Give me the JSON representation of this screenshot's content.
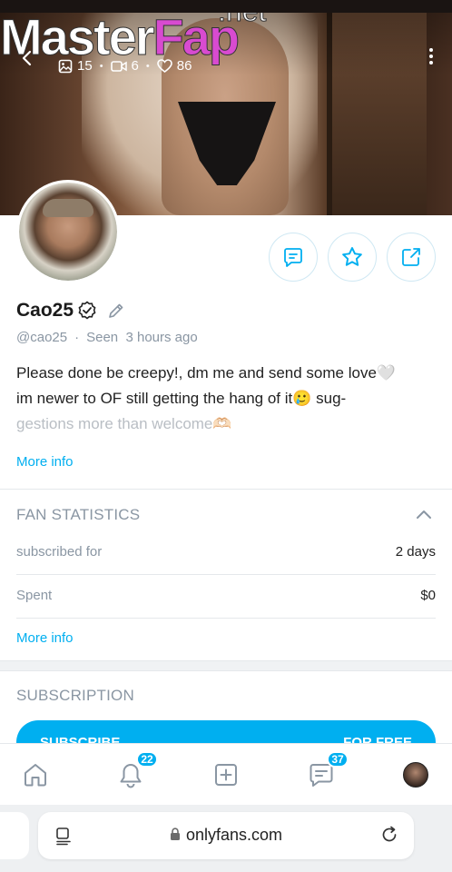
{
  "watermark": {
    "part1": "Master",
    "part2": "Fap",
    "suffix": ".net"
  },
  "cover": {
    "stats": [
      {
        "icon": "image-icon",
        "value": "15"
      },
      {
        "icon": "video-icon",
        "value": "6"
      },
      {
        "icon": "heart-icon",
        "value": "86"
      }
    ]
  },
  "profile": {
    "name": "Cao25",
    "handle": "@cao25",
    "separator": "·",
    "seen": "Seen  3 hours ago",
    "bio_line1": "Please done be creepy!, dm me and send some love🤍",
    "bio_line2": "im newer to OF still getting the hang of it🥲 sug-",
    "bio_line3": "gestions more than welcome🫶🏻",
    "more_info": "More info"
  },
  "fan_statistics": {
    "title": "FAN STATISTICS",
    "rows": [
      {
        "label": "subscribed for",
        "value": "2 days"
      },
      {
        "label": "Spent",
        "value": "$0"
      }
    ],
    "more_info": "More info"
  },
  "subscription": {
    "title": "SUBSCRIPTION",
    "button_left": "SUBSCRIBE",
    "button_right": "FOR FREE"
  },
  "bottom_nav": {
    "notifications_badge": "22",
    "messages_badge": "37"
  },
  "browser": {
    "url": "onlyfans.com"
  },
  "colors": {
    "accent": "#00aff0",
    "muted": "#8a96a3"
  }
}
